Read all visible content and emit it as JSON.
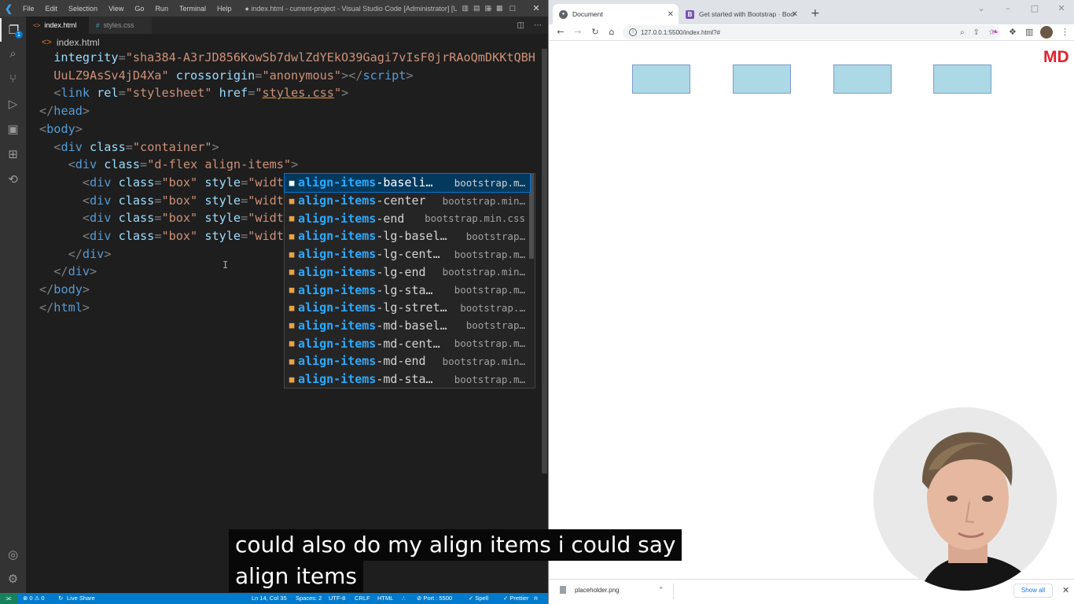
{
  "vscode": {
    "menu": [
      "File",
      "Edit",
      "Selection",
      "View",
      "Go",
      "Run",
      "Terminal",
      "Help"
    ],
    "window_title": "● index.html - current-project - Visual Studio Code [Administrator] [Unsu...",
    "activity_badge": "1",
    "tabs": [
      {
        "label": "index.html",
        "modified": true,
        "active": true
      },
      {
        "label": "styles.css",
        "active": false
      }
    ],
    "breadcrumb": "index.html",
    "code_lines": [
      [
        [
          "at",
          "  integrity"
        ],
        [
          "pu",
          "="
        ],
        [
          "sv",
          "\"sha384-A3rJD856KowSb7dwlZdYEkO39Gagi7vIsF0jrRAoQmDKKtQBH"
        ]
      ],
      [
        [
          "sv",
          "  UuLZ9AsSv4jD4Xa\""
        ],
        [
          "at",
          " crossorigin"
        ],
        [
          "pu",
          "="
        ],
        [
          "sv",
          "\"anonymous\""
        ],
        [
          "pu",
          "></"
        ],
        [
          "tg",
          "script"
        ],
        [
          "pu",
          ">"
        ]
      ],
      [
        [
          "pu",
          "  <"
        ],
        [
          "tg",
          "link"
        ],
        [
          "at",
          " rel"
        ],
        [
          "pu",
          "="
        ],
        [
          "sv",
          "\"stylesheet\""
        ],
        [
          "at",
          " href"
        ],
        [
          "pu",
          "="
        ],
        [
          "sv",
          "\""
        ],
        [
          "svu",
          "styles.css"
        ],
        [
          "sv",
          "\""
        ],
        [
          "pu",
          ">"
        ]
      ],
      [
        [
          "pu",
          "</"
        ],
        [
          "tg",
          "head"
        ],
        [
          "pu",
          ">"
        ]
      ],
      [
        [
          "pu",
          "<"
        ],
        [
          "tg",
          "body"
        ],
        [
          "pu",
          ">"
        ]
      ],
      [
        [
          "pu",
          "  <"
        ],
        [
          "tg",
          "div"
        ],
        [
          "at",
          " class"
        ],
        [
          "pu",
          "="
        ],
        [
          "sv",
          "\"container\""
        ],
        [
          "pu",
          ">"
        ]
      ],
      [
        [
          "pu",
          "    <"
        ],
        [
          "tg",
          "div"
        ],
        [
          "at",
          " class"
        ],
        [
          "pu",
          "="
        ],
        [
          "sv",
          "\"d-flex align-items\""
        ],
        [
          "pu",
          ">"
        ]
      ],
      [
        [
          "pu",
          "      <"
        ],
        [
          "tg",
          "div"
        ],
        [
          "at",
          " class"
        ],
        [
          "pu",
          "="
        ],
        [
          "sv",
          "\"box\""
        ],
        [
          "at",
          " style"
        ],
        [
          "pu",
          "="
        ],
        [
          "sv",
          "\"widt"
        ]
      ],
      [
        [
          "pu",
          "      <"
        ],
        [
          "tg",
          "div"
        ],
        [
          "at",
          " class"
        ],
        [
          "pu",
          "="
        ],
        [
          "sv",
          "\"box\""
        ],
        [
          "at",
          " style"
        ],
        [
          "pu",
          "="
        ],
        [
          "sv",
          "\"widt"
        ]
      ],
      [
        [
          "pu",
          "      <"
        ],
        [
          "tg",
          "div"
        ],
        [
          "at",
          " class"
        ],
        [
          "pu",
          "="
        ],
        [
          "sv",
          "\"box\""
        ],
        [
          "at",
          " style"
        ],
        [
          "pu",
          "="
        ],
        [
          "sv",
          "\"widt"
        ]
      ],
      [
        [
          "pu",
          "      <"
        ],
        [
          "tg",
          "div"
        ],
        [
          "at",
          " class"
        ],
        [
          "pu",
          "="
        ],
        [
          "sv",
          "\"box\""
        ],
        [
          "at",
          " style"
        ],
        [
          "pu",
          "="
        ],
        [
          "sv",
          "\"widt"
        ]
      ],
      [
        [
          "pu",
          "    </"
        ],
        [
          "tg",
          "div"
        ],
        [
          "pu",
          ">"
        ]
      ],
      [
        [
          "pu",
          "  </"
        ],
        [
          "tg",
          "div"
        ],
        [
          "pu",
          ">"
        ]
      ],
      [
        [
          "pu",
          "</"
        ],
        [
          "tg",
          "body"
        ],
        [
          "pu",
          ">"
        ]
      ],
      [
        [
          "pu",
          "</"
        ],
        [
          "tg",
          "html"
        ],
        [
          "pu",
          ">"
        ]
      ]
    ],
    "suggestions": [
      {
        "label": "align-items-baseli…",
        "detail": "bootstrap.m…",
        "selected": true
      },
      {
        "label": "align-items-center",
        "detail": "bootstrap.min…"
      },
      {
        "label": "align-items-end",
        "detail": "bootstrap.min.css"
      },
      {
        "label": "align-items-lg-basel…",
        "detail": "bootstrap…"
      },
      {
        "label": "align-items-lg-cent…",
        "detail": "bootstrap.m…"
      },
      {
        "label": "align-items-lg-end",
        "detail": "bootstrap.min…"
      },
      {
        "label": "align-items-lg-sta…",
        "detail": "bootstrap.m…"
      },
      {
        "label": "align-items-lg-stret…",
        "detail": "bootstrap.…"
      },
      {
        "label": "align-items-md-basel…",
        "detail": "bootstrap…"
      },
      {
        "label": "align-items-md-cent…",
        "detail": "bootstrap.m…"
      },
      {
        "label": "align-items-md-end",
        "detail": "bootstrap.min…"
      },
      {
        "label": "align-items-md-sta…",
        "detail": "bootstrap.m…"
      }
    ],
    "suggest_match": "align-items",
    "status": {
      "problems": "⊗ 0 ⚠ 0",
      "live_share": "Live Share",
      "position": "Ln 14, Col 35",
      "spaces": "Spaces: 2",
      "encoding": "UTF-8",
      "eol": "CRLF",
      "language": "HTML",
      "port": "⊘ Port : 5500",
      "spell": "✓ Spell",
      "prettier": "✓ Prettier"
    }
  },
  "browser": {
    "tabs": [
      {
        "title": "Document",
        "active": true
      },
      {
        "title": "Get started with Bootstrap · Boot",
        "active": false
      }
    ],
    "url": "127.0.0.1:5500/index.html?#",
    "page_logo": "MD",
    "box_color": "#add8e6",
    "download": {
      "filename": "placeholder.png",
      "show_all": "Show all"
    }
  },
  "captions": {
    "line1": "could also do my align items i could say",
    "line2": "align items"
  },
  "colors": {
    "vscode_accent": "#007acc",
    "tag": "#569cd6",
    "attribute": "#9cdcfe",
    "string": "#ce9178",
    "suggest_highlight": "#2aaaff"
  }
}
